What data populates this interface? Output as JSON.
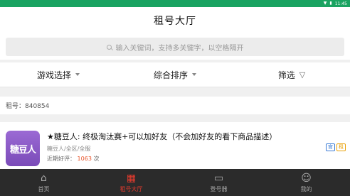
{
  "statusbar": {
    "time": "11:45",
    "wifi_icon": "wifi-icon",
    "battery_icon": "battery-icon"
  },
  "header": {
    "title": "租号大厅"
  },
  "search": {
    "placeholder": "输入关键词，支持多关键字，以空格隔开"
  },
  "filters": [
    {
      "label": "游戏选择"
    },
    {
      "label": "综合排序"
    },
    {
      "label": "筛选"
    }
  ],
  "listing": {
    "account_label": "租号：840854",
    "thumb_text": "糖豆人",
    "title": "★糖豆人: 终极淘汰赛+可以加好友（不会加好友的看下商品描述）",
    "subtitle": "糖豆人/全区/全服",
    "rating_label": "近期好评：",
    "rating_value": "1063",
    "rating_unit": "次",
    "badges": [
      "官",
      "租"
    ]
  },
  "tabbar": {
    "tabs": [
      {
        "label": "首页",
        "icon": "home-icon"
      },
      {
        "label": "租号大厅",
        "icon": "rent-icon"
      },
      {
        "label": "登号器",
        "icon": "monitor-icon"
      },
      {
        "label": "我的",
        "icon": "user-icon"
      }
    ]
  },
  "colors": {
    "accent": "#e23b2e",
    "statusbar": "#1aa361",
    "tabbar_bg": "#2b2b2b"
  }
}
